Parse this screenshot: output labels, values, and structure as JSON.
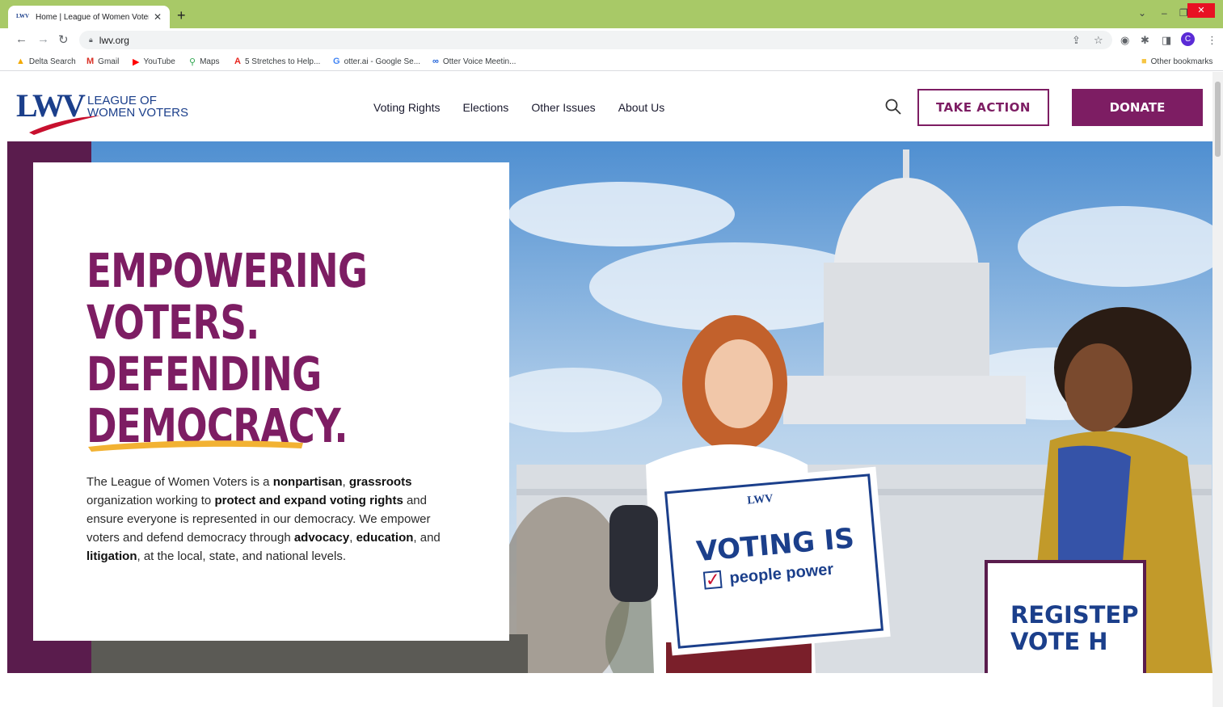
{
  "browser": {
    "tab_title": "Home | League of Women Voters",
    "tab_favicon": "LWV",
    "url": "lwv.org",
    "bookmarks": [
      {
        "label": "Delta Search",
        "icon": "delta-icon",
        "color": "#f2a900"
      },
      {
        "label": "Gmail",
        "icon": "gmail-icon",
        "color": "#d93025"
      },
      {
        "label": "YouTube",
        "icon": "youtube-icon",
        "color": "#ff0000"
      },
      {
        "label": "Maps",
        "icon": "maps-icon",
        "color": "#34a853"
      },
      {
        "label": "5 Stretches to Help...",
        "icon": "acrobat-icon",
        "color": "#e8251f"
      },
      {
        "label": "otter.ai - Google Se...",
        "icon": "google-icon",
        "color": "#4285f4"
      },
      {
        "label": "Otter Voice Meetin...",
        "icon": "otter-icon",
        "color": "#1b5fd9"
      }
    ],
    "other_bookmarks": "Other bookmarks",
    "profile_initial": "C",
    "tabbar_color": "#a8c967"
  },
  "site": {
    "logo": {
      "mark": "LWV",
      "line1": "LEAGUE OF",
      "line2": "WOMEN VOTERS"
    },
    "nav": [
      "Voting Rights",
      "Elections",
      "Other Issues",
      "About Us"
    ],
    "take_action": "TAKE ACTION",
    "donate": "DONATE",
    "brand_purple": "#7d1d63",
    "brand_blue": "#1b3f8b"
  },
  "hero": {
    "headline": [
      "EMPOWERING",
      "VOTERS.",
      "DEFENDING",
      "DEMOCRACY."
    ],
    "body": {
      "p1": "The League of Women Voters is a ",
      "b1": "nonpartisan",
      "p2": ", ",
      "b2": "grassroots",
      "p3": " organization working to ",
      "b3": "protect and expand voting rights",
      "p4": " and ensure everyone is represented in our democracy. We empower voters and defend democracy through ",
      "b4": "advocacy",
      "p5": ", ",
      "b5": "education",
      "p6": ", and ",
      "b6": "litigation",
      "p7": ", at the local, state, and national levels."
    },
    "sign1": {
      "logo": "LWV",
      "big": "VOTING IS",
      "small": "people power"
    },
    "sign2": {
      "line1": "REGISTEP",
      "line2": "VOTE H"
    }
  }
}
